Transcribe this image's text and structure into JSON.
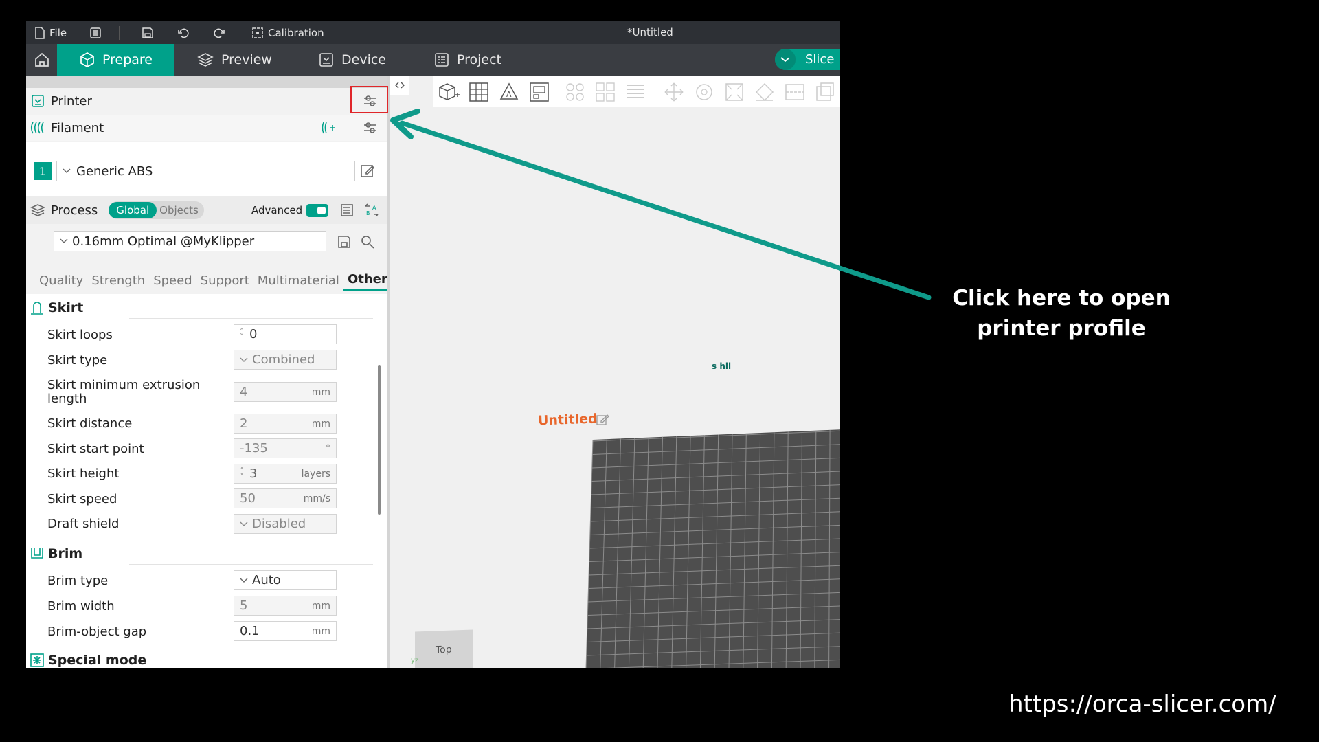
{
  "window": {
    "title": "*Untitled"
  },
  "titlebar": {
    "file_label": "File",
    "calibration_label": "Calibration"
  },
  "nav": {
    "tabs": [
      {
        "label": "Prepare",
        "active": true
      },
      {
        "label": "Preview",
        "active": false
      },
      {
        "label": "Device",
        "active": false
      },
      {
        "label": "Project",
        "active": false
      }
    ],
    "slice_label": "Slice"
  },
  "printer": {
    "label": "Printer"
  },
  "filament": {
    "label": "Filament",
    "slot_number": "1",
    "selected": "Generic ABS"
  },
  "process": {
    "label": "Process",
    "scope_global": "Global",
    "scope_objects": "Objects",
    "advanced_label": "Advanced",
    "advanced_enabled": true,
    "preset": "0.16mm Optimal @MyKlipper"
  },
  "settings_tabs": [
    "Quality",
    "Strength",
    "Speed",
    "Support",
    "Multimaterial",
    "Others"
  ],
  "active_settings_tab": "Others",
  "skirt": {
    "title": "Skirt",
    "loops": {
      "label": "Skirt loops",
      "value": "0"
    },
    "type": {
      "label": "Skirt type",
      "value": "Combined"
    },
    "min_extrusion": {
      "label_line1": "Skirt minimum extrusion",
      "label_line2": "length",
      "value": "4",
      "unit": "mm"
    },
    "distance": {
      "label": "Skirt distance",
      "value": "2",
      "unit": "mm"
    },
    "start_point": {
      "label": "Skirt start point",
      "value": "-135",
      "unit": "°"
    },
    "height": {
      "label": "Skirt height",
      "value": "3",
      "unit": "layers"
    },
    "speed": {
      "label": "Skirt speed",
      "value": "50",
      "unit": "mm/s"
    },
    "draft_shield": {
      "label": "Draft shield",
      "value": "Disabled"
    }
  },
  "brim": {
    "title": "Brim",
    "type": {
      "label": "Brim type",
      "value": "Auto"
    },
    "width": {
      "label": "Brim width",
      "value": "5",
      "unit": "mm"
    },
    "gap": {
      "label": "Brim-object gap",
      "value": "0.1",
      "unit": "mm"
    }
  },
  "special_mode": {
    "title": "Special mode"
  },
  "viewport": {
    "plate_name": "Untitled",
    "view_cube_label": "Top",
    "marker_text": "s hll",
    "axis_text": "yz"
  },
  "annotation": {
    "line1": "Click here to open",
    "line2": "printer profile"
  },
  "footer_url": "https://orca-slicer.com/",
  "colors": {
    "accent": "#00a18a",
    "highlight_box": "#e0262a",
    "plate_label": "#e8662b",
    "arrow": "#0f9a8a"
  }
}
